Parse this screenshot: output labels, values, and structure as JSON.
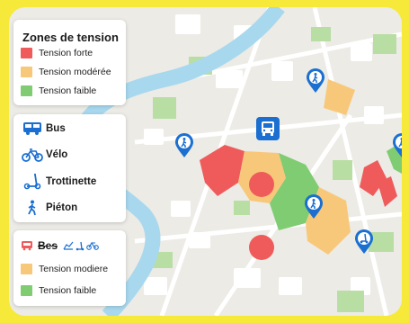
{
  "colors": {
    "frame": "#f7e93a",
    "map_bg": "#ecebe6",
    "river": "#a8d8ee",
    "park": "#b9dea4",
    "block": "#ffffff",
    "tension_high": "#ef5b5b",
    "tension_moderate": "#f8c87a",
    "tension_low": "#7fcc72",
    "pin_blue": "#1a6fd1"
  },
  "legend_zones": {
    "title": "Zones de tension",
    "items": [
      {
        "label": "Tension forte",
        "color": "#ef5b5b"
      },
      {
        "label": "Tension modérée",
        "color": "#f8c87a"
      },
      {
        "label": "Tension faible",
        "color": "#7fcc72"
      }
    ]
  },
  "legend_modes": {
    "items": [
      {
        "label": "Bus",
        "icon": "bus-icon"
      },
      {
        "label": "Vélo",
        "icon": "bicycle-icon"
      },
      {
        "label": "Trottinette",
        "icon": "scooter-icon"
      },
      {
        "label": "Piéton",
        "icon": "pedestrian-icon"
      }
    ]
  },
  "legend_bottom": {
    "header_label": "Bes",
    "header_icons": [
      "bus-icon",
      "chart-icon",
      "scooter-icon",
      "bicycle-icon"
    ],
    "items": [
      {
        "label": "Tension modiere",
        "color": "#f8c87a"
      },
      {
        "label": "Tension faible",
        "color": "#7fcc72"
      }
    ]
  },
  "map_markers": [
    {
      "icon": "pedestrian-icon",
      "kind": "pin"
    },
    {
      "icon": "bus-icon",
      "kind": "stop"
    },
    {
      "icon": "pedestrian-icon",
      "kind": "pin"
    },
    {
      "icon": "pedestrian-icon",
      "kind": "pin"
    },
    {
      "icon": "scooter-icon",
      "kind": "pin"
    },
    {
      "icon": "pedestrian-icon",
      "kind": "pin"
    }
  ]
}
